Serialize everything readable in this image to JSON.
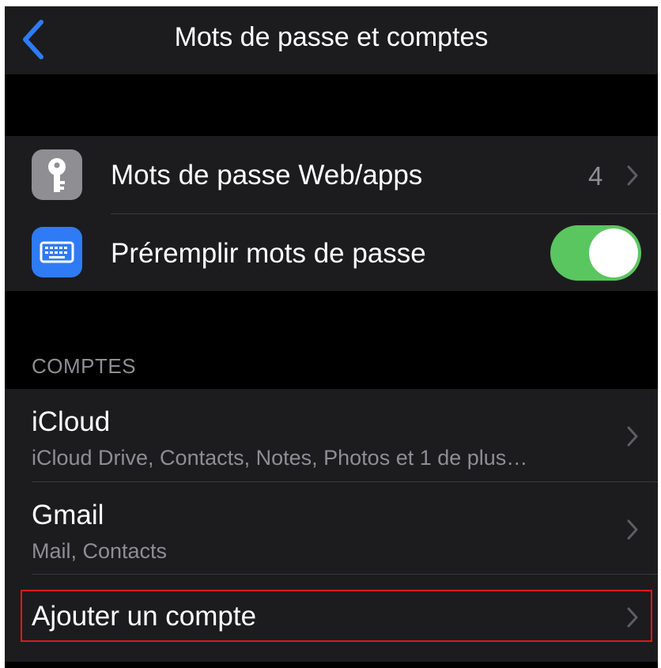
{
  "nav": {
    "title": "Mots de passe et comptes",
    "back_icon": "chevron-left-icon"
  },
  "passwords_group": {
    "web_passwords": {
      "label": "Mots de passe Web/apps",
      "count": "4",
      "icon": "key-icon"
    },
    "autofill": {
      "label": "Préremplir mots de passe",
      "icon": "keyboard-icon",
      "enabled": true
    }
  },
  "accounts_section": {
    "header": "COMPTES",
    "items": [
      {
        "title": "iCloud",
        "subtitle": "iCloud Drive, Contacts, Notes, Photos et 1 de plus…"
      },
      {
        "title": "Gmail",
        "subtitle": "Mail, Contacts"
      }
    ],
    "add_account": "Ajouter un compte"
  },
  "colors": {
    "background": "#000000",
    "cell": "#1c1c1e",
    "accent_blue": "#2f7bf5",
    "toggle_on": "#5ac65f",
    "secondary_text": "#8e8e93",
    "highlight": "#e4161b"
  }
}
